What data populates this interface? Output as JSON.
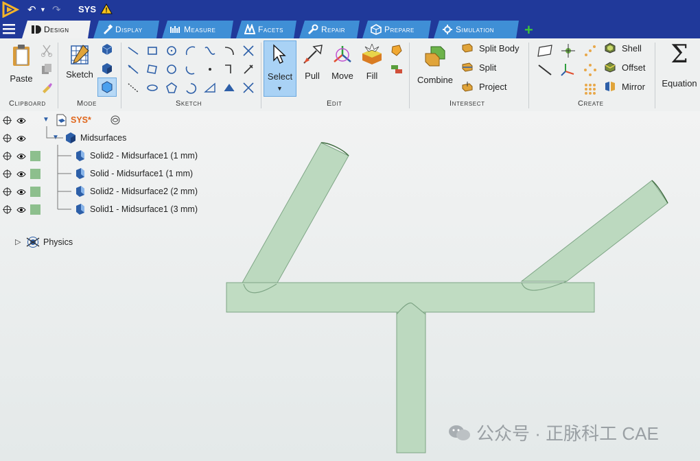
{
  "window": {
    "title": "SYS"
  },
  "tabs": [
    {
      "label": "Design",
      "active": true
    },
    {
      "label": "Display",
      "active": false
    },
    {
      "label": "Measure",
      "active": false
    },
    {
      "label": "Facets",
      "active": false
    },
    {
      "label": "Repair",
      "active": false
    },
    {
      "label": "Prepare",
      "active": false
    },
    {
      "label": "Simulation",
      "active": false
    }
  ],
  "ribbon": {
    "groups": {
      "clipboard": "Clipboard",
      "mode": "Mode",
      "sketch": "Sketch",
      "edit": "Edit",
      "intersect": "Intersect",
      "create": "Create"
    },
    "paste": "Paste",
    "sketch": "Sketch",
    "select": "Select",
    "pull": "Pull",
    "move": "Move",
    "fill": "Fill",
    "combine": "Combine",
    "split_body": "Split Body",
    "split": "Split",
    "project": "Project",
    "shell": "Shell",
    "offset": "Offset",
    "mirror": "Mirror",
    "equation": "Equation"
  },
  "tree": {
    "root": "SYS*",
    "midsurfaces": "Midsurfaces",
    "items": [
      {
        "label": "Solid2 - Midsurface1  (1 mm)"
      },
      {
        "label": "Solid - Midsurface1  (1 mm)"
      },
      {
        "label": "Solid2 - Midsurface2  (2 mm)"
      },
      {
        "label": "Solid1 - Midsurface1  (3 mm)"
      }
    ],
    "physics": "Physics"
  },
  "watermark": "公众号 · 正脉科工 CAE",
  "colors": {
    "titlebar": "#20399a",
    "tab": "#3f8fd6",
    "pipe_fill": "#bcd9bf",
    "pipe_stroke": "#7ea585"
  }
}
